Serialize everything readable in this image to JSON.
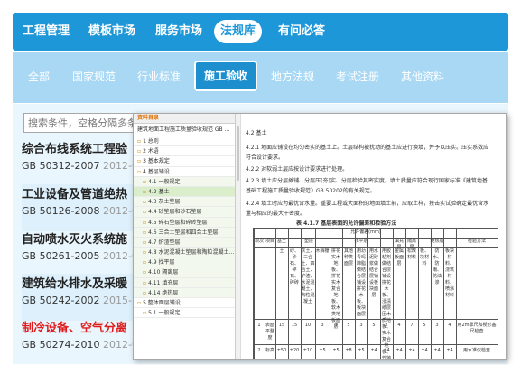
{
  "top_nav": {
    "items": [
      "工程管理",
      "模板市场",
      "服务市场",
      "法规库",
      "有问必答"
    ],
    "active": "法规库"
  },
  "sub_nav": {
    "items": [
      "全部",
      "国家规范",
      "行业标准",
      "施工验收",
      "地方法规",
      "考试注册",
      "其他资料"
    ],
    "active": "施工验收"
  },
  "search": {
    "placeholder": "搜索条件，空格分隔多条件"
  },
  "standards": [
    {
      "title": "综合布线系统工程验",
      "code": "GB 50312-2007",
      "year": "2012-0"
    },
    {
      "title": "工业设备及管道绝热",
      "code": "GB 50126-2008",
      "year": "2012-0"
    },
    {
      "title": "自动喷水灭火系统施",
      "code": "GB 50261-2005",
      "year": "2012-0"
    },
    {
      "title": "建筑给水排水及采暖",
      "code": "GB 50242-2002",
      "year": "2015-"
    },
    {
      "title": "制冷设备、空气分离",
      "code": "GB 50274-2010",
      "year": "2012-0"
    }
  ],
  "viewer": {
    "toc": {
      "header": "资料目录",
      "book": "建筑地面工程施工质量验收规范 GB ...",
      "items": [
        "1 总则",
        "2 术语",
        "3 基本规定",
        "4 基层铺设",
        "4.1 一般规定",
        "4.2 基土",
        "4.3 灰土垫层",
        "4.4 砂垫层和砂石垫层",
        "4.5 碎石垫层和碎砖垫层",
        "4.6 三合土垫层和四合土垫层",
        "4.7 炉渣垫层",
        "4.8 水泥混凝土垫层和陶粒混凝土...",
        "4.9 找平层",
        "4.10 隔离层",
        "4.11 填充层",
        "4.14 绝热层",
        "5 整体面层铺设",
        "5.1 一般规定"
      ],
      "selected": "4.2 基土"
    },
    "doc": {
      "heading": "4.2 基土",
      "paragraphs": [
        "4.2.1 地面应铺设在均匀密实的基土上。土层结构被扰动的基土应进行换填，并予以压实。压实系数应",
        "符合设计要求。",
        "4.2.2 对软弱土层应按设计要求进行处理。",
        "4.2.3 填土应分层摊铺、分层压(夯)实、分层检验其密实度。填土质量应符合现行国家标准《建筑地基",
        "基础工程施工质量验收规范》GB 50202的有关规定。",
        "4.2.4 填土时应为最优含水量。重要工程或大面积的地面填土前，应取土样，按击实试验确定最优含水",
        "量与相应的最大干密度。"
      ],
      "table_title": "表 4.1.7  基层表面的允许偏差和检验方法",
      "table": {
        "col_headers": [
          "项次",
          "项目",
          "基土",
          "垫层",
          "找平层",
          "填充层",
          "隔离层",
          "绝热层",
          "检验方法"
        ],
        "top_header": "允许偏差(mm)",
        "sub_headers": [
          "土",
          "砂、砂石、碎石、碎砖",
          "灰土、三合土、四合土、炉渣、水泥混凝土、陶粒混凝土",
          "木搁栅",
          "拼花实木地板、拼花实木复合地板、软木类地板面层",
          "其他种类面层",
          "用沥青玛蹄脂做结合层铺设拼花木板、板块面层",
          "用水泥砂浆做结合层铺设板块面层",
          "用胶粘剂做结合层铺设拼花木板、浸渍纸层压木质地板、实木复合地板、竹地板、软木地板面层",
          "金属板面层",
          "松散材料",
          "板、块材料",
          "防水、防潮、防油渗",
          "板块材料、浇筑材料、喷涂材料"
        ],
        "rows": [
          [
            "1",
            "表面平整度",
            "15",
            "15",
            "10",
            "3",
            "3",
            "5",
            "3",
            "5",
            "2",
            "4",
            "7",
            "5",
            "3",
            "4",
            "用2m靠尺和楔形塞尺检查"
          ],
          [
            "2",
            "标高",
            "±50",
            "±20",
            "±10",
            "±5",
            "±5",
            "±8",
            "±5",
            "±4",
            "±4",
            "±4",
            "±4",
            "±4",
            "±4",
            "±4",
            "用水准仪检查"
          ]
        ]
      }
    }
  },
  "colors": {
    "brand": "#1d97d8",
    "sub_nav_bg": "#a9d8f4",
    "active_tab": "#1d8fce",
    "highlight_red": "#e01b1b"
  }
}
